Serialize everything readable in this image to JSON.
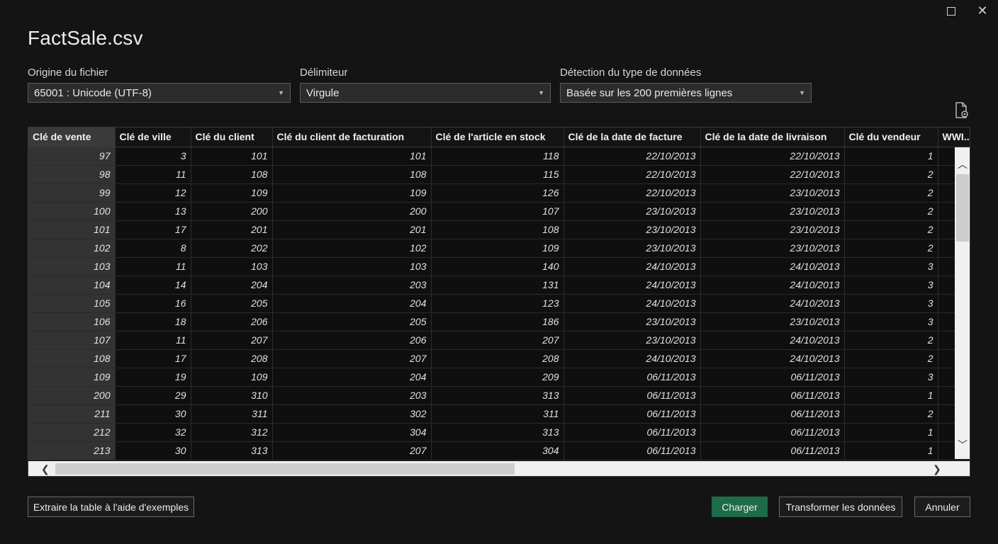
{
  "window": {
    "title": "FactSale.csv"
  },
  "options": {
    "origin": {
      "label": "Origine du fichier",
      "value": "65001 : Unicode (UTF-8)"
    },
    "delimiter": {
      "label": "Délimiteur",
      "value": "Virgule"
    },
    "detection": {
      "label": "Détection du type de données",
      "value": "Basée sur les 200 premières lignes"
    }
  },
  "table": {
    "columns": [
      "Clé de vente",
      "Clé de ville",
      "Clé du client",
      "Clé du client de facturation",
      "Clé de l'article en stock",
      "Clé de la date de facture",
      "Clé de la date de livraison",
      "Clé du vendeur",
      "WWI..."
    ],
    "rows": [
      [
        "97",
        "3",
        "101",
        "101",
        "118",
        "22/10/2013",
        "22/10/2013",
        "1"
      ],
      [
        "98",
        "11",
        "108",
        "108",
        "115",
        "22/10/2013",
        "22/10/2013",
        "2"
      ],
      [
        "99",
        "12",
        "109",
        "109",
        "126",
        "22/10/2013",
        "23/10/2013",
        "2"
      ],
      [
        "100",
        "13",
        "200",
        "200",
        "107",
        "23/10/2013",
        "23/10/2013",
        "2"
      ],
      [
        "101",
        "17",
        "201",
        "201",
        "108",
        "23/10/2013",
        "23/10/2013",
        "2"
      ],
      [
        "102",
        "8",
        "202",
        "102",
        "109",
        "23/10/2013",
        "23/10/2013",
        "2"
      ],
      [
        "103",
        "11",
        "103",
        "103",
        "140",
        "24/10/2013",
        "24/10/2013",
        "3"
      ],
      [
        "104",
        "14",
        "204",
        "203",
        "131",
        "24/10/2013",
        "24/10/2013",
        "3"
      ],
      [
        "105",
        "16",
        "205",
        "204",
        "123",
        "24/10/2013",
        "24/10/2013",
        "3"
      ],
      [
        "106",
        "18",
        "206",
        "205",
        "186",
        "23/10/2013",
        "23/10/2013",
        "3"
      ],
      [
        "107",
        "11",
        "207",
        "206",
        "207",
        "23/10/2013",
        "24/10/2013",
        "2"
      ],
      [
        "108",
        "17",
        "208",
        "207",
        "208",
        "24/10/2013",
        "24/10/2013",
        "2"
      ],
      [
        "109",
        "19",
        "109",
        "204",
        "209",
        "06/11/2013",
        "06/11/2013",
        "3"
      ],
      [
        "200",
        "29",
        "310",
        "203",
        "313",
        "06/11/2013",
        "06/11/2013",
        "1"
      ],
      [
        "211",
        "30",
        "311",
        "302",
        "311",
        "06/11/2013",
        "06/11/2013",
        "2"
      ],
      [
        "212",
        "32",
        "312",
        "304",
        "313",
        "06/11/2013",
        "06/11/2013",
        "1"
      ],
      [
        "213",
        "30",
        "313",
        "207",
        "304",
        "06/11/2013",
        "06/11/2013",
        "1"
      ]
    ]
  },
  "icons": {
    "maximize": "maximize-icon",
    "close": "close-icon",
    "document_settings": "document-settings-icon"
  },
  "buttons": {
    "extract": "Extraire la table à l'aide d'exemples",
    "load": "Charger",
    "transform": "Transformer les données",
    "cancel": "Annuler"
  },
  "colors": {
    "primary_button": "#1e6b4a"
  }
}
